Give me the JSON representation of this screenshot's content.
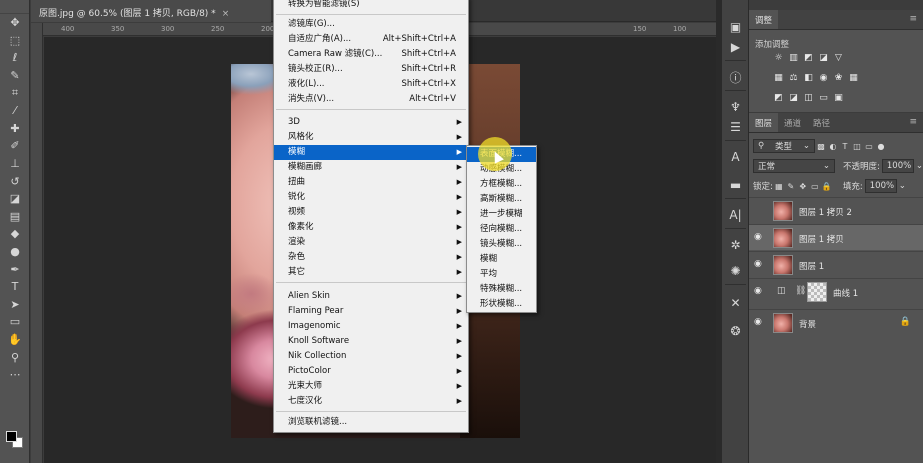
{
  "document": {
    "tab_title": "原图.jpg @ 60.5% (图层 1 拷贝, RGB/8) *",
    "close_glyph": "×",
    "ruler_ticks": [
      "400",
      "350",
      "300",
      "250",
      "200",
      "150",
      "100",
      "50",
      "0"
    ]
  },
  "filter_menu": {
    "top_item": "转换为智能滤镜(S)",
    "group1": [
      {
        "label": "滤镜库(G)...",
        "shortcut": ""
      },
      {
        "label": "自适应广角(A)...",
        "shortcut": "Alt+Shift+Ctrl+A"
      },
      {
        "label": "Camera Raw 滤镜(C)...",
        "shortcut": "Shift+Ctrl+A"
      },
      {
        "label": "镜头校正(R)...",
        "shortcut": "Shift+Ctrl+R"
      },
      {
        "label": "液化(L)...",
        "shortcut": "Shift+Ctrl+X"
      },
      {
        "label": "消失点(V)...",
        "shortcut": "Alt+Ctrl+V"
      }
    ],
    "group2": [
      "3D",
      "风格化",
      "模糊",
      "模糊画廊",
      "扭曲",
      "锐化",
      "视频",
      "像素化",
      "渲染",
      "杂色",
      "其它"
    ],
    "highlighted": "模糊",
    "group3": [
      "Alien Skin",
      "Flaming Pear",
      "Imagenomic",
      "Knoll Software",
      "Nik Collection",
      "PictoColor",
      "光束大师",
      "七度汉化"
    ],
    "bottom_item": "浏览联机滤镜..."
  },
  "blur_submenu": {
    "items": [
      "表面模糊...",
      "动感模糊...",
      "方框模糊...",
      "高斯模糊...",
      "进一步模糊",
      "径向模糊...",
      "镜头模糊...",
      "模糊",
      "平均",
      "特殊模糊...",
      "形状模糊..."
    ],
    "highlighted": "表面模糊..."
  },
  "adjustments_panel": {
    "tab": "调整",
    "add_label": "添加调整"
  },
  "layers_panel": {
    "tabs": [
      "图层",
      "通道",
      "路径"
    ],
    "kind_filter": "类型",
    "blend_mode": "正常",
    "opacity_label": "不透明度:",
    "opacity_value": "100%",
    "lock_label": "锁定:",
    "fill_label": "填充:",
    "fill_value": "100%",
    "layers": [
      {
        "name": "图层 1 拷贝 2",
        "visible": false,
        "selected": false
      },
      {
        "name": "图层 1 拷贝",
        "visible": true,
        "selected": true
      },
      {
        "name": "图层 1",
        "visible": true,
        "selected": false
      },
      {
        "name": "曲线 1",
        "visible": true,
        "selected": false,
        "type": "adjustment"
      },
      {
        "name": "背景",
        "visible": true,
        "selected": false,
        "locked": true
      }
    ]
  },
  "colors": {
    "menu_highlight": "#0a64c8",
    "panel_bg": "#535353",
    "canvas_bg": "#282828"
  }
}
